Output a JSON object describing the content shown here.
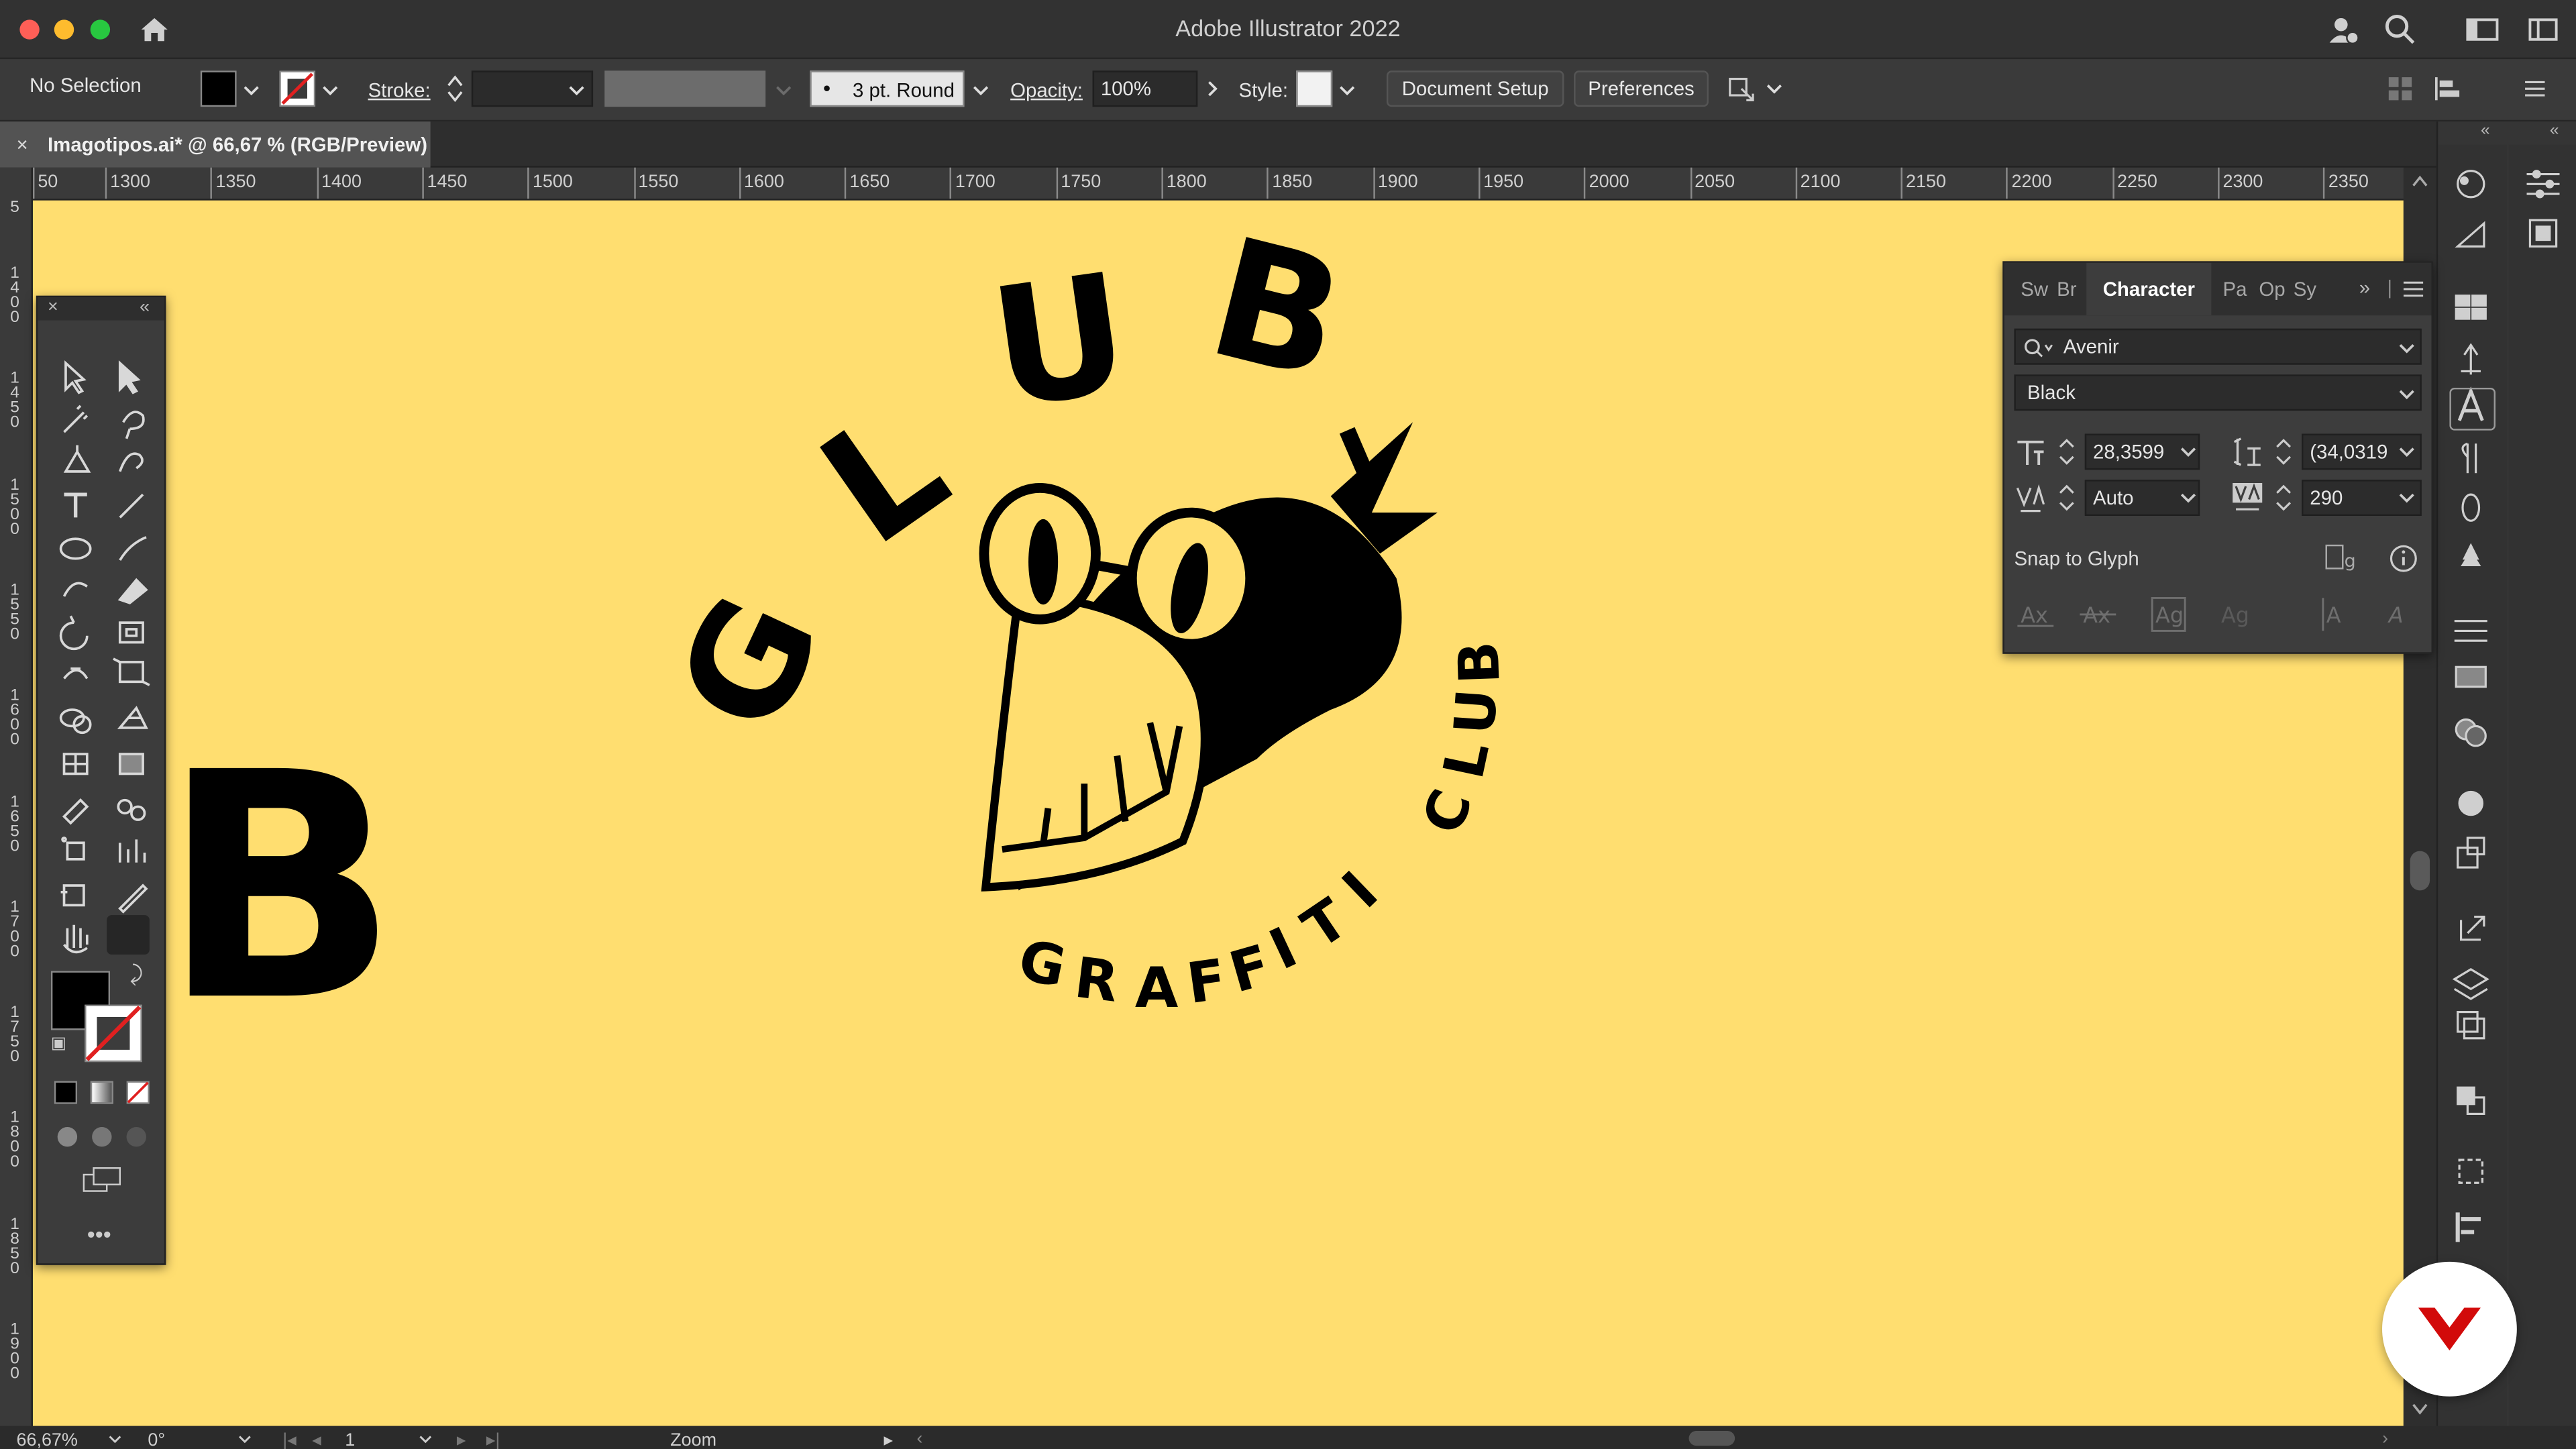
{
  "window": {
    "title": "Adobe Illustrator 2022"
  },
  "control_bar": {
    "selection": "No Selection",
    "stroke_label": "Stroke:",
    "brush": "3 pt. Round",
    "opacity_label": "Opacity:",
    "opacity_value": "100%",
    "style_label": "Style:",
    "document_setup": "Document Setup",
    "preferences": "Preferences"
  },
  "document_tab": {
    "close": "×",
    "title": "Imagotipos.ai* @ 66,67 % (RGB/Preview)"
  },
  "ruler_h": [
    "50",
    "1300",
    "1350",
    "1400",
    "1450",
    "1500",
    "1550",
    "1600",
    "1650",
    "1700",
    "1750",
    "1800",
    "1850",
    "1900",
    "1950",
    "2000",
    "2050",
    "2100",
    "2150",
    "2200",
    "2250",
    "2300",
    "2350"
  ],
  "ruler_v": [
    "5",
    "1400",
    "1450",
    "1500",
    "1550",
    "1600",
    "1650",
    "1700",
    "1750",
    "1800",
    "1850",
    "1900"
  ],
  "artwork": {
    "arc_letters_top": [
      "G",
      "L",
      "U",
      "B"
    ],
    "arc_letters_right": [
      "C",
      "L",
      "U",
      "B"
    ],
    "arc_letters_bottom": [
      "G",
      "R",
      "A",
      "F",
      "F",
      "I",
      "T",
      "I"
    ],
    "partial_letter": "B"
  },
  "character_panel": {
    "tabs": [
      "Sw",
      "Br",
      "Character",
      "Pa",
      "Op",
      "Sy"
    ],
    "font_family": "Avenir",
    "font_style": "Black",
    "font_size": "28,3599",
    "leading": "(34,0319",
    "kerning": "Auto",
    "tracking": "290",
    "snap_to_glyph": "Snap to Glyph"
  },
  "status_bar": {
    "zoom": "66,67%",
    "rotation": "0°",
    "artboard": "1",
    "tool": "Zoom"
  },
  "colors": {
    "artboard_bg": "#ffde70",
    "ink": "#000000",
    "badge_red": "#d20a0a"
  }
}
